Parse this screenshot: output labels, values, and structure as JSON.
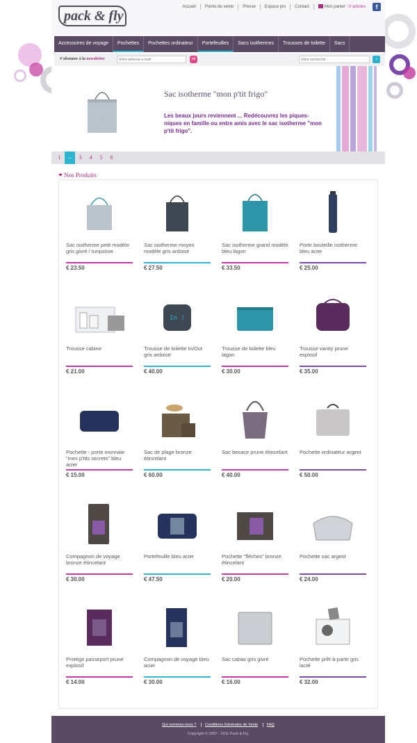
{
  "header": {
    "logo": "pack & fly",
    "links": [
      "Accueil",
      "Points de vente",
      "Presse",
      "Espace pro",
      "Contact"
    ],
    "cart_label": "Mon panier :",
    "cart_count": "0 articles",
    "facebook": "f"
  },
  "nav": {
    "items": [
      "Accessoires de voyage",
      "Pochettes",
      "Pochettes ordinateur",
      "Portefeuilles",
      "Sacs isothermes",
      "Trousses de toilette",
      "Sacs"
    ]
  },
  "newsletter": {
    "label_prefix": "S'abonner à la",
    "label_highlight": "newsletter",
    "placeholder": "Votre adresse e-mail",
    "button": "ok"
  },
  "search": {
    "placeholder": "Votre recherche",
    "button": "›"
  },
  "banner": {
    "title": "Sac isotherme \"mon p'tit frigo\"",
    "text": "Les beaux jours reviennent ... Redécouvrez les piques-niques en famille ou entre amis avec le sac isotherme \"mon p'tit frigo\"."
  },
  "pager": {
    "pages": [
      "1",
      "–",
      "3",
      "4",
      "5",
      "6"
    ],
    "current_index": 1
  },
  "section_title": "Nos Produits",
  "products": [
    {
      "name": "Sac isotherme petit modèle gris givré / turquoise",
      "price": "€ 23.50",
      "line": "#c2389f",
      "img": "tote-small"
    },
    {
      "name": "Sac isotherme moyen modèle gris ardoise",
      "price": "€ 27.50",
      "line": "#2fb4cf",
      "img": "tote-dark"
    },
    {
      "name": "Sac isotherme grand modèle bleu lagon",
      "price": "€ 33.50",
      "line": "#c2389f",
      "img": "tote-teal"
    },
    {
      "name": "Porte bouteille isotherme bleu acier",
      "price": "€ 25.00",
      "line": "#7a4aa8",
      "img": "bottle"
    },
    {
      "name": "Trousse cabine",
      "price": "€ 21.00",
      "line": "#c2389f",
      "img": "clear-kit"
    },
    {
      "name": "Trousse de toilette In/Out gris ardoise",
      "price": "€ 40.00",
      "line": "#2fb4cf",
      "img": "toiletry-dark"
    },
    {
      "name": "Trousse de toilette bleu lagon",
      "price": "€ 30.00",
      "line": "#c2389f",
      "img": "pouch-teal"
    },
    {
      "name": "Trousse vanity prune explosif",
      "price": "€ 35.00",
      "line": "#7a4aa8",
      "img": "vanity-plum"
    },
    {
      "name": "Pochette - porte monnaie \"mes p'tits secrets\" bleu acier",
      "price": "€ 15.00",
      "line": "#c2389f",
      "img": "pouch-navy"
    },
    {
      "name": "Sac de plage bronze étincelant",
      "price": "€ 60.00",
      "line": "#2fb4cf",
      "img": "beach-bag"
    },
    {
      "name": "Sac besace prune étincelant",
      "price": "€ 40.00",
      "line": "#c2389f",
      "img": "besace"
    },
    {
      "name": "Pochette ordinateur argent",
      "price": "€ 50.00",
      "line": "#7a4aa8",
      "img": "laptop"
    },
    {
      "name": "Compagnon de voyage bronze étincelant",
      "price": "€ 30.00",
      "line": "#c2389f",
      "img": "wallet-bronze"
    },
    {
      "name": "Portefeuille bleu acier",
      "price": "€ 47.50",
      "line": "#2fb4cf",
      "img": "wallet-navy"
    },
    {
      "name": "Pochette \"flèches\" bronze étincelant",
      "price": "€ 20.00",
      "line": "#c2389f",
      "img": "clutch-bronze"
    },
    {
      "name": "Pochette sac argent",
      "price": "€ 24.00",
      "line": "#7a4aa8",
      "img": "clutch-silver"
    },
    {
      "name": "Protège passeport prune explosif",
      "price": "€ 14.00",
      "line": "#c2389f",
      "img": "passport-plum"
    },
    {
      "name": "Compagnon de voyage bleu acier",
      "price": "€ 30.00",
      "line": "#2fb4cf",
      "img": "wallet-tall-navy"
    },
    {
      "name": "Sac cabas gris givré",
      "price": "€ 16.00",
      "line": "#c2389f",
      "img": "cabas-silver"
    },
    {
      "name": "Pochette prêt-à-partir gris lacté",
      "price": "€ 32.00",
      "line": "#7a4aa8",
      "img": "pochette-clear"
    }
  ],
  "footer": {
    "links": [
      "Qui sommes-nous ?",
      "Conditions Générales de Vente",
      "FAQ"
    ],
    "copyright": "Copyright © 2007 - 2011 Pack & Fly."
  },
  "colors": {
    "nav": "#5b4a64",
    "accent_pink": "#c2389f",
    "accent_teal": "#2fb4cf",
    "accent_purple": "#7a4aa8"
  }
}
